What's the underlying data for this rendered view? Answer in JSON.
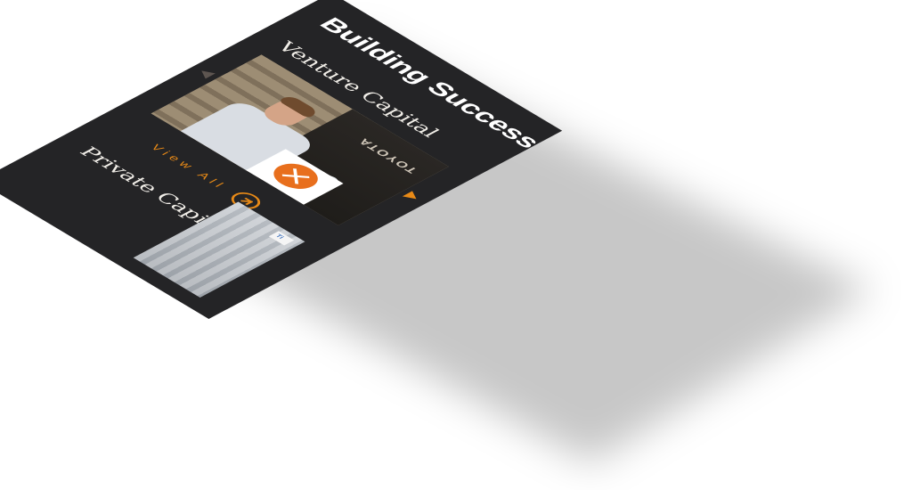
{
  "page": {
    "title": "Building Success"
  },
  "sections": {
    "venture": {
      "label": "Venture Capital"
    },
    "private": {
      "label": "Private Capital"
    }
  },
  "cta": {
    "view_all": "View All"
  },
  "media": {
    "machine_label": "TOYOTA",
    "private_logo": "Ti"
  },
  "colors": {
    "background": "#242426",
    "accent": "#e88a17",
    "text": "#ffffff",
    "badge": "#e86f1d"
  },
  "icons": {
    "next": "arrow-right-icon",
    "prev": "arrow-left-icon",
    "view_all": "arrow-up-right-icon"
  }
}
